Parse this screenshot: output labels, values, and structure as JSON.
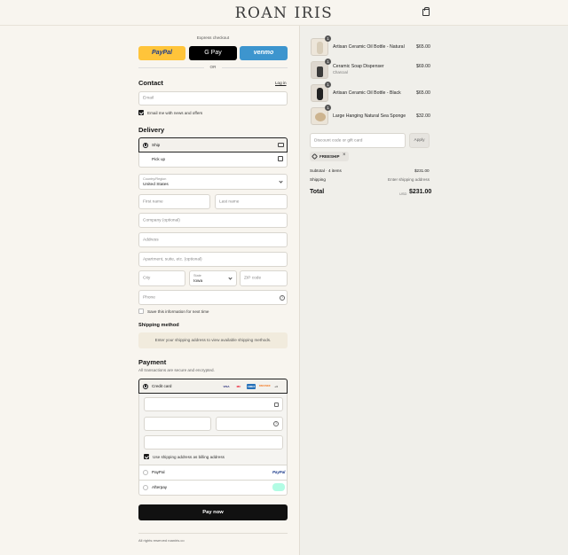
{
  "brand": "ROAN IRIS",
  "express": {
    "label": "Express checkout",
    "paypal": "PayPal",
    "gpay": "G Pay",
    "venmo": "venmo",
    "or": "OR"
  },
  "contact": {
    "heading": "Contact",
    "login": "Log in",
    "email_placeholder": "Email",
    "news_label": "Email me with news and offers"
  },
  "delivery": {
    "heading": "Delivery",
    "ship": "Ship",
    "pickup": "Pick up",
    "country_label": "Country/Region",
    "country_value": "United States",
    "first_name": "First name",
    "last_name": "Last name",
    "company": "Company (optional)",
    "address": "Address",
    "apartment": "Apartment, suite, etc. (optional)",
    "city": "City",
    "state_label": "State",
    "state_value": "Iowa",
    "zip": "ZIP code",
    "phone": "Phone",
    "save_label": "Save this information for next time"
  },
  "shipping_method": {
    "heading": "Shipping method",
    "notice": "Enter your shipping address to view available shipping methods."
  },
  "payment": {
    "heading": "Payment",
    "subtext": "All transactions are secure and encrypted.",
    "credit_card": "Credit card",
    "billing_label": "Use shipping address as billing address",
    "paypal": "PayPal",
    "paypal_logo": "PayPal",
    "afterpay": "Afterpay",
    "card_brands": [
      "VISA",
      "MC",
      "AMEX",
      "DISCOVER",
      "+4"
    ]
  },
  "pay_now": "Pay now",
  "footer": "All rights reserved roaniris.co",
  "cart": {
    "items": [
      {
        "name": "Artisan Ceramic Oil Bottle - Natural",
        "variant": "",
        "qty": "1",
        "price": "$65.00"
      },
      {
        "name": "Ceramic Soap Dispenser",
        "variant": "Charcoal",
        "qty": "1",
        "price": "$69.00"
      },
      {
        "name": "Artisan Ceramic Oil Bottle - Black",
        "variant": "",
        "qty": "1",
        "price": "$65.00"
      },
      {
        "name": "Large Hanging Natural Sea Sponge",
        "variant": "",
        "qty": "1",
        "price": "$32.00"
      }
    ],
    "discount_placeholder": "Discount code or gift card",
    "apply": "Apply",
    "code": "FREESHIP",
    "subtotal_label": "Subtotal · 4 items",
    "subtotal_value": "$231.00",
    "shipping_label": "Shipping",
    "shipping_value": "Enter shipping address",
    "total_label": "Total",
    "currency": "USD",
    "total_value": "$231.00"
  }
}
